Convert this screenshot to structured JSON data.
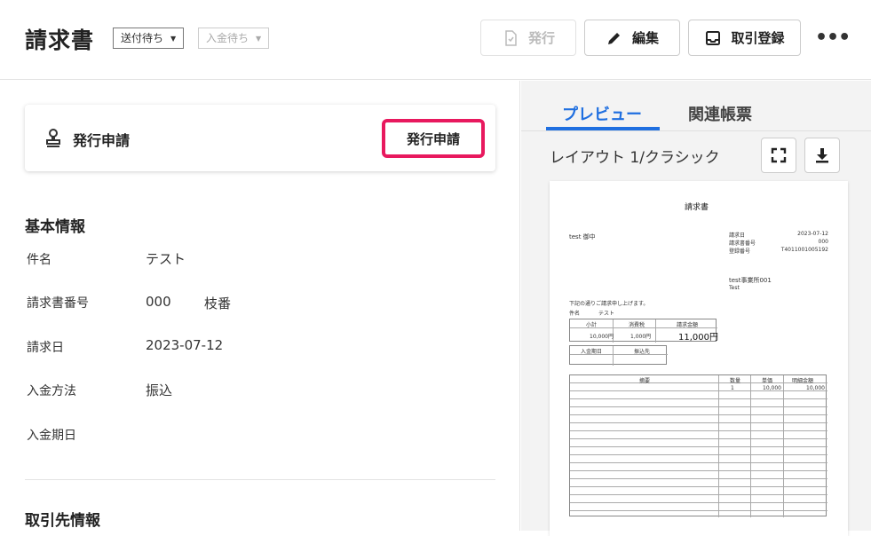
{
  "header": {
    "title": "請求書",
    "status_sent": "送付待ち",
    "status_payment": "入金待ち",
    "issue_label": "発行",
    "edit_label": "編集",
    "register_label": "取引登録",
    "more_label": "•••"
  },
  "issue_request": {
    "title": "発行申請",
    "button_label": "発行申請"
  },
  "basic_info": {
    "title": "基本情報",
    "fields": [
      {
        "label": "件名",
        "value": "テスト"
      },
      {
        "label": "請求書番号",
        "value": "000",
        "extra": "枝番"
      },
      {
        "label": "請求日",
        "value": "2023-07-12"
      },
      {
        "label": "入金方法",
        "value": "振込"
      },
      {
        "label": "入金期日",
        "value": ""
      }
    ]
  },
  "client_info": {
    "title": "取引先情報"
  },
  "preview": {
    "tabs": [
      "プレビュー",
      "関連帳票"
    ],
    "layout_label": "レイアウト 1/クラシック",
    "doc": {
      "title": "請求書",
      "recipient": "test 御中",
      "meta_labels": [
        "請求日",
        "請求書番号",
        "登録番号"
      ],
      "meta_values": [
        "2023-07-12",
        "000",
        "T4011001005192"
      ],
      "issuer": "test事業所001",
      "issuer_sub": "Test",
      "intro": "下記の通りご請求申し上げます。",
      "subject_label": "件名",
      "subject_value": "テスト",
      "summary_headers": [
        "小計",
        "消費税",
        "請求金額"
      ],
      "summary_values": [
        "10,000円",
        "1,000円",
        "11,000円"
      ],
      "due_headers": [
        "入金期日",
        "振込先"
      ],
      "items_headers": [
        "摘要",
        "数量",
        "単価",
        "明細金額"
      ],
      "items_row": [
        "",
        "1",
        "10,000",
        "10,000"
      ]
    }
  }
}
